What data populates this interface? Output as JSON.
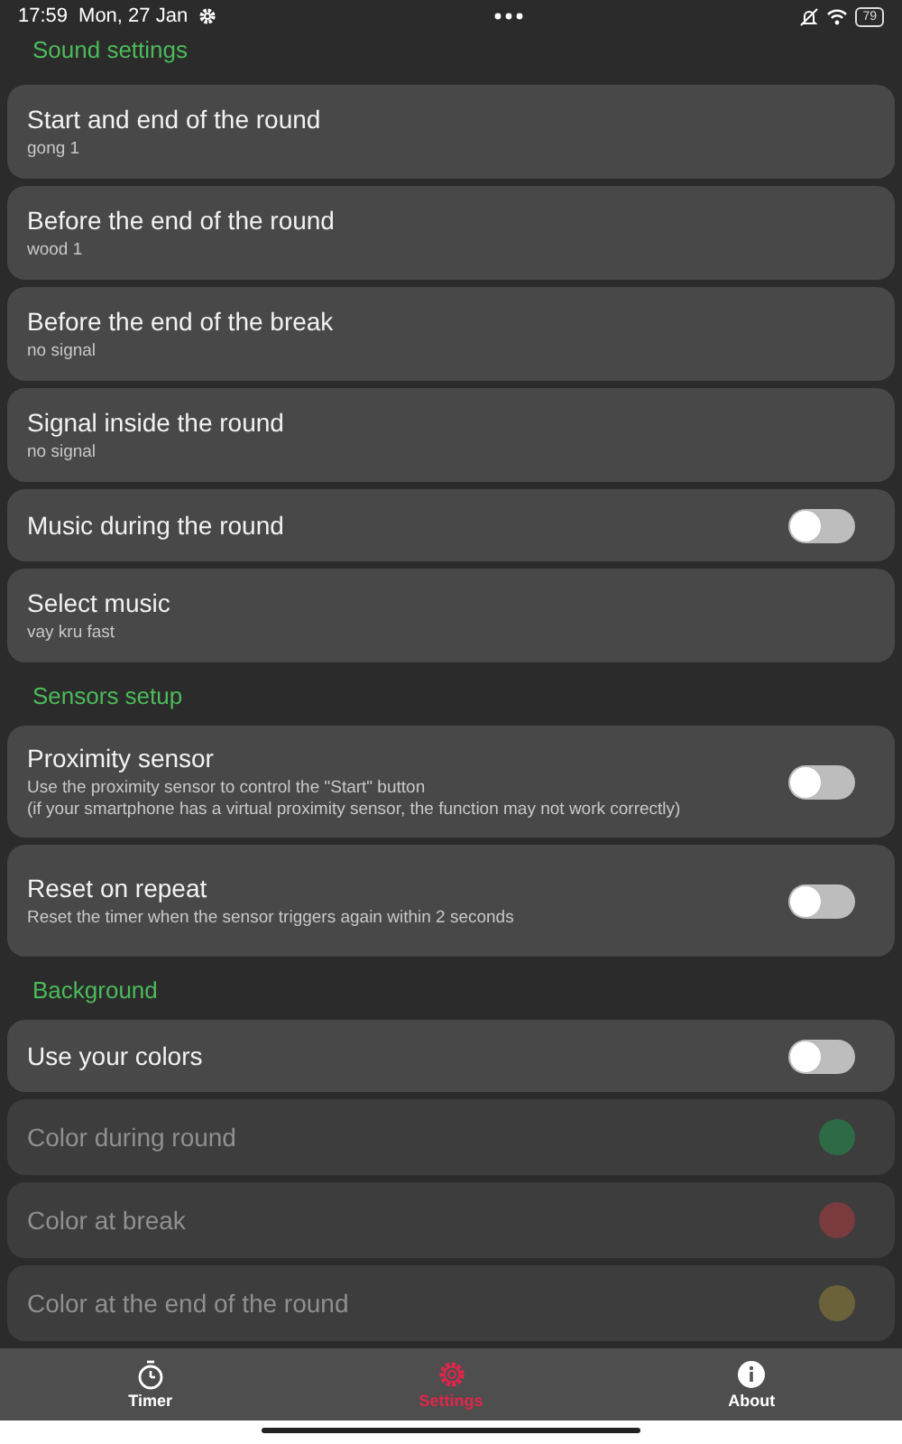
{
  "status_bar": {
    "time": "17:59",
    "date": "Mon, 27 Jan",
    "battery": "79"
  },
  "sections": [
    {
      "title": "Sound settings",
      "items": [
        {
          "kind": "value",
          "label": "Start and end of the round",
          "value": "gong 1",
          "disabled": false
        },
        {
          "kind": "value",
          "label": "Before the end of the round",
          "value": "wood 1",
          "disabled": false
        },
        {
          "kind": "value",
          "label": "Before the end of the break",
          "value": "no signal",
          "disabled": false
        },
        {
          "kind": "value",
          "label": "Signal inside the round",
          "value": "no signal",
          "disabled": false
        },
        {
          "kind": "toggle",
          "label": "Music during the round",
          "on": false,
          "disabled": false
        },
        {
          "kind": "value",
          "label": "Select music",
          "value": "vay kru fast",
          "disabled": false
        }
      ]
    },
    {
      "title": "Sensors setup",
      "items": [
        {
          "kind": "toggle",
          "label": "Proximity sensor",
          "description": [
            "Use the proximity sensor to control the \"Start\" button",
            "(if your smartphone has a virtual proximity sensor, the function may not work correctly)"
          ],
          "on": false,
          "disabled": false
        },
        {
          "kind": "toggle",
          "label": "Reset on repeat",
          "description": [
            "Reset the timer when the sensor triggers again within 2 seconds"
          ],
          "on": false,
          "disabled": false
        }
      ]
    },
    {
      "title": "Background",
      "items": [
        {
          "kind": "toggle",
          "label": "Use your colors",
          "on": false,
          "disabled": false
        },
        {
          "kind": "color",
          "label": "Color during round",
          "color": "#2e6a46",
          "disabled": true
        },
        {
          "kind": "color",
          "label": "Color at break",
          "color": "#7a3b3e",
          "disabled": true
        },
        {
          "kind": "color",
          "label": "Color at the end of the round",
          "color": "#6b623a",
          "disabled": true
        }
      ]
    }
  ],
  "tabs": [
    {
      "kind": "timer",
      "label": "Timer",
      "selected": false
    },
    {
      "kind": "settings",
      "label": "Settings",
      "selected": true
    },
    {
      "kind": "about",
      "label": "About",
      "selected": false
    }
  ]
}
